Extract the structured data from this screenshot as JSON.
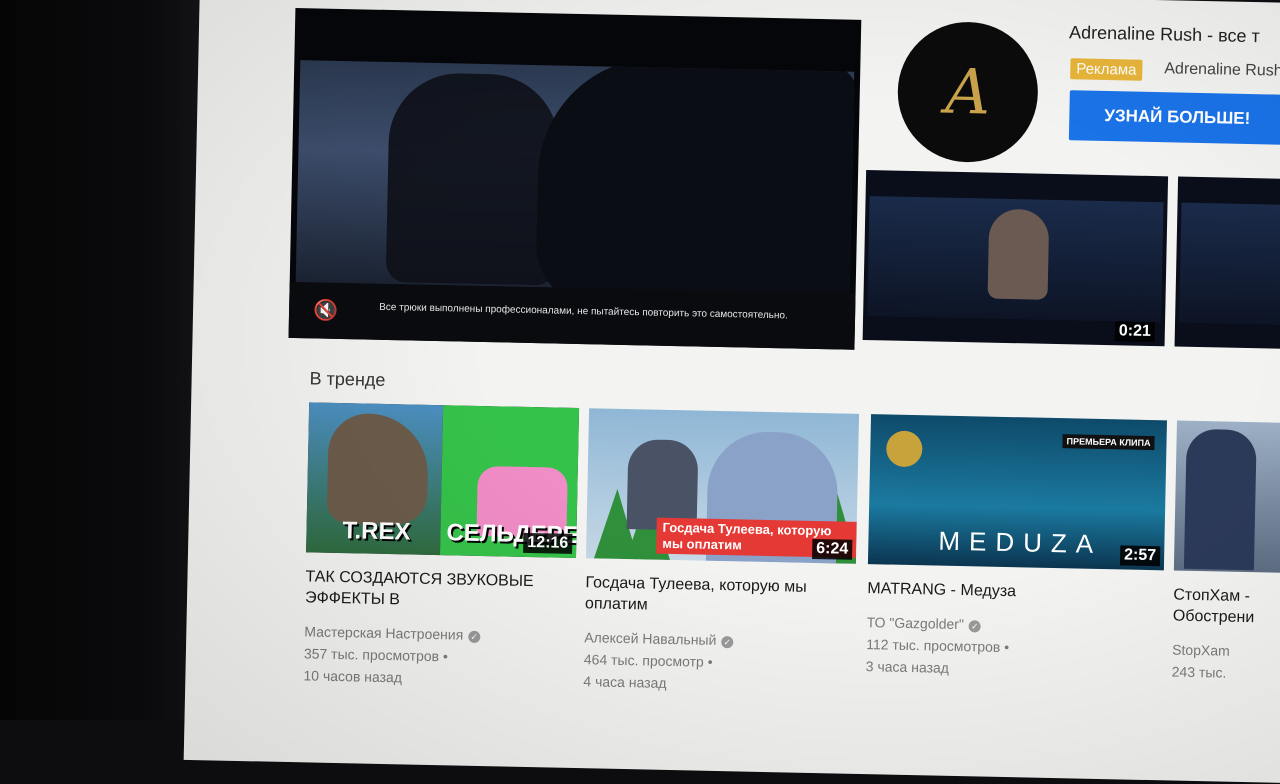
{
  "ad": {
    "caption": "Все трюки выполнены профессионалами, не пытайтесь повторить это самостоятельно.",
    "logo_letter": "A",
    "title": "Adrenaline Rush - все т",
    "badge": "Реклама",
    "channel": "Adrenaline Rush",
    "cta": "УЗНАЙ БОЛЬШЕ!",
    "side_duration": "0:21"
  },
  "trending": {
    "title": "В тренде",
    "videos": [
      {
        "thumb_text_left": "T.REX",
        "thumb_text_right": "СЕЛЬДЕРЕЙ",
        "duration": "12:16",
        "title": "ТАК СОЗДАЮТСЯ ЗВУКОВЫЕ ЭФФЕКТЫ В",
        "channel": "Мастерская Настроения",
        "views": "357 тыс. просмотров •",
        "age": "10 часов назад"
      },
      {
        "thumb_banner": "Госдача Тулеева, которую мы оплатим",
        "duration": "6:24",
        "title": "Госдача Тулеева, которую мы оплатим",
        "channel": "Алексей Навальный",
        "views": "464 тыс. просмотр •",
        "age": "4 часа назад"
      },
      {
        "thumb_title": "MEDUZA",
        "thumb_badge": "ПРЕМЬЕРА КЛИПА",
        "duration": "2:57",
        "title": "MATRANG - Медуза",
        "channel": "ТО \"Gazgolder\"",
        "views": "112 тыс. просмотров •",
        "age": "3 часа назад"
      },
      {
        "title": "СтопХам - Обострени",
        "channel": "StopXam",
        "views": "243 тыс.",
        "age": ""
      }
    ]
  }
}
